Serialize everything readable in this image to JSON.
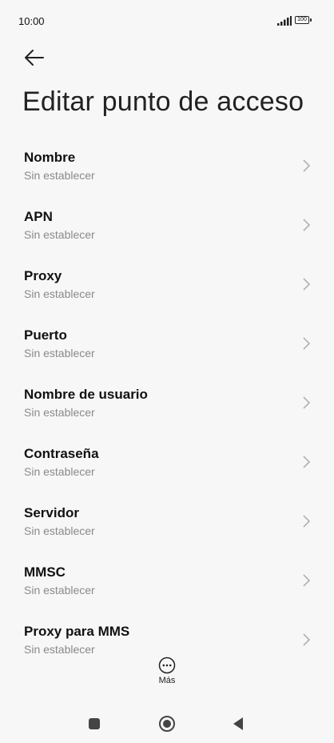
{
  "status_bar": {
    "time": "10:00",
    "battery": "100"
  },
  "header": {
    "title": "Editar punto de acceso"
  },
  "items": [
    {
      "title": "Nombre",
      "value": "Sin establecer"
    },
    {
      "title": "APN",
      "value": "Sin establecer"
    },
    {
      "title": "Proxy",
      "value": "Sin establecer"
    },
    {
      "title": "Puerto",
      "value": "Sin establecer"
    },
    {
      "title": "Nombre de usuario",
      "value": "Sin establecer"
    },
    {
      "title": "Contraseña",
      "value": "Sin establecer"
    },
    {
      "title": "Servidor",
      "value": "Sin establecer"
    },
    {
      "title": "MMSC",
      "value": "Sin establecer"
    },
    {
      "title": "Proxy para MMS",
      "value": "Sin establecer"
    }
  ],
  "bottom": {
    "more_label": "Más",
    "more_icon": "more-horizontal-circle-icon"
  },
  "nav": {
    "recents_icon": "square-icon",
    "home_icon": "circle-icon",
    "back_icon": "triangle-back-icon"
  },
  "colors": {
    "background": "#f7f7f7",
    "subtitle": "#8a8a8a",
    "chevron": "#b0b0b0"
  }
}
